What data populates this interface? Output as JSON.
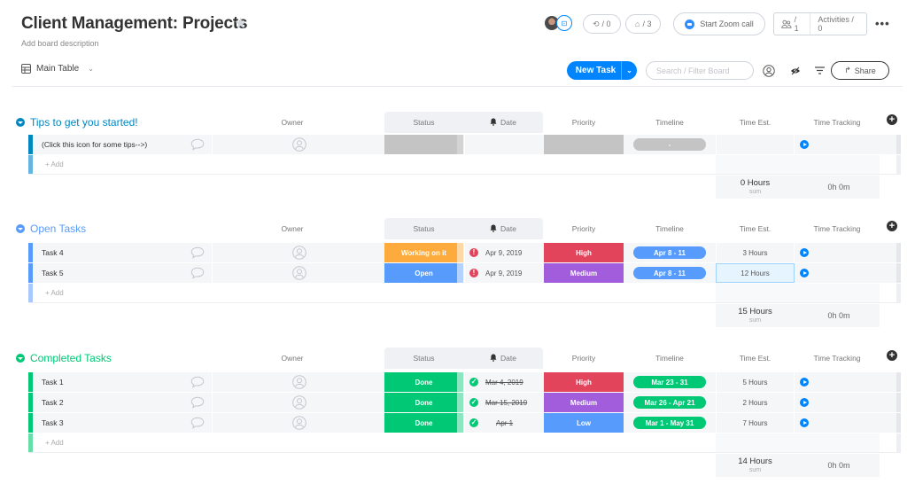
{
  "header": {
    "title": "Client Management: Projects",
    "description": "Add board description",
    "view": "Main Table",
    "integrations_count": "/ 0",
    "automations_count": "/ 3",
    "zoom_label": "Start Zoom call",
    "members_count": "/ 1",
    "activities_label": "Activities / 0"
  },
  "toolbar": {
    "new_task_label": "New Task",
    "search_placeholder": "Search / Filter Board",
    "share_label": "Share"
  },
  "columns": {
    "owner": "Owner",
    "status": "Status",
    "date": "Date",
    "priority": "Priority",
    "timeline": "Timeline",
    "time_est": "Time Est.",
    "time_tracking": "Time Tracking"
  },
  "add_label": "+ Add",
  "sum_label": "sum",
  "colors": {
    "tips_group": "#0086c0",
    "open_group": "#579bfc",
    "completed_group": "#00c875",
    "working_on_it": "#fdab3d",
    "open": "#579bfc",
    "done": "#00c875",
    "high": "#e2445c",
    "medium": "#a25ddc",
    "low": "#579bfc",
    "empty": "#c4c4c4",
    "primary": "#0085ff"
  },
  "groups": [
    {
      "title": "Tips to get you started!",
      "rows": [
        {
          "name": "(Click this icon for some tips-->)",
          "status": "",
          "date": "",
          "priority": "",
          "timeline": "-",
          "est": ""
        }
      ],
      "sum_hours": "0 Hours",
      "sum_tracking": "0h 0m"
    },
    {
      "title": "Open Tasks",
      "rows": [
        {
          "name": "Task 4",
          "status": "Working on it",
          "date": "Apr 9, 2019",
          "priority": "High",
          "timeline": "Apr 8 - 11",
          "est": "3 Hours"
        },
        {
          "name": "Task 5",
          "status": "Open",
          "date": "Apr 9, 2019",
          "priority": "Medium",
          "timeline": "Apr 8 - 11",
          "est": "12 Hours"
        }
      ],
      "sum_hours": "15 Hours",
      "sum_tracking": "0h 0m"
    },
    {
      "title": "Completed Tasks",
      "rows": [
        {
          "name": "Task 1",
          "status": "Done",
          "date": "Mar 4, 2019",
          "priority": "High",
          "timeline": "Mar 23 - 31",
          "est": "5 Hours"
        },
        {
          "name": "Task 2",
          "status": "Done",
          "date": "Mar 15, 2019",
          "priority": "Medium",
          "timeline": "Mar 26 - Apr 21",
          "est": "2 Hours"
        },
        {
          "name": "Task 3",
          "status": "Done",
          "date": "Apr 1",
          "priority": "Low",
          "timeline": "Mar 1 - May 31",
          "est": "7 Hours"
        }
      ],
      "sum_hours": "14 Hours",
      "sum_tracking": "0h 0m"
    }
  ]
}
